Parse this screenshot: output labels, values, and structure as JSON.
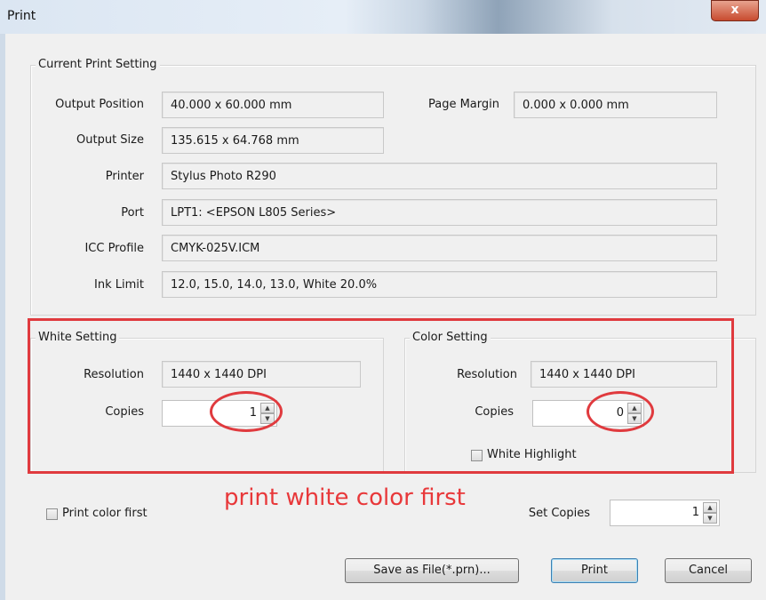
{
  "window": {
    "title": "Print",
    "close_glyph": "x"
  },
  "current_print_setting": {
    "group_label": "Current Print Setting",
    "output_position": {
      "label": "Output Position",
      "value": "40.000 x 60.000 mm"
    },
    "page_margin": {
      "label": "Page Margin",
      "value": "0.000 x 0.000 mm"
    },
    "output_size": {
      "label": "Output Size",
      "value": "135.615 x 64.768 mm"
    },
    "printer": {
      "label": "Printer",
      "value": "Stylus Photo R290"
    },
    "port": {
      "label": "Port",
      "value": "LPT1:  <EPSON L805 Series>"
    },
    "icc_profile": {
      "label": "ICC Profile",
      "value": "CMYK-025V.ICM"
    },
    "ink_limit": {
      "label": "Ink Limit",
      "value": "12.0, 15.0, 14.0, 13.0, White 20.0%"
    }
  },
  "white_setting": {
    "group_label": "White Setting",
    "resolution": {
      "label": "Resolution",
      "value": "1440 x 1440 DPI"
    },
    "copies": {
      "label": "Copies",
      "value": "1"
    }
  },
  "color_setting": {
    "group_label": "Color Setting",
    "resolution": {
      "label": "Resolution",
      "value": "1440 x 1440 DPI"
    },
    "copies": {
      "label": "Copies",
      "value": "0"
    },
    "white_highlight": {
      "label": "White Highlight",
      "checked": false
    }
  },
  "bottom": {
    "print_color_first": {
      "label": "Print color first",
      "checked": false
    },
    "annotation": "print white color first",
    "set_copies": {
      "label": "Set Copies",
      "value": "1"
    }
  },
  "buttons": {
    "save_as_file": "Save as File(*.prn)...",
    "print": "Print",
    "cancel": "Cancel"
  },
  "colors": {
    "annotation_red": "#e03a3e",
    "close_button": "#c84b2f"
  }
}
